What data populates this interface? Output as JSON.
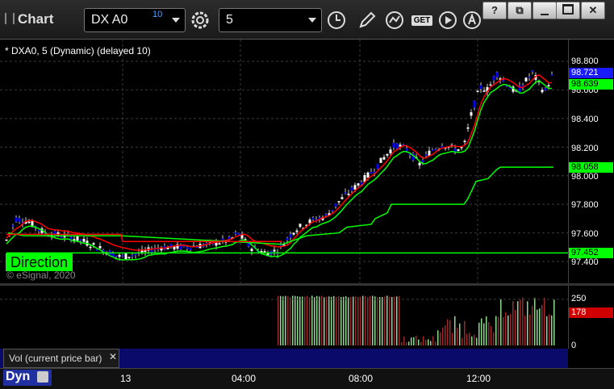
{
  "window": {
    "title": "Chart",
    "buttons": {
      "help": "?",
      "restore": "⧉",
      "minimize": "",
      "maximize": "",
      "close": "✕"
    }
  },
  "toolbar": {
    "symbol": "DX A0",
    "delay": "10",
    "interval": "5",
    "get_label": "GET",
    "icons": [
      "settings-gear-icon",
      "clock-icon",
      "pencil-icon",
      "study-icon",
      "get-data-icon",
      "play-icon",
      "alert-icon"
    ]
  },
  "chart": {
    "study_line": "* DXA0, 5 (Dynamic) (delayed 10)",
    "direction_label": "Direction",
    "copyright": "© eSignal, 2020",
    "price_axis": [
      "98.800",
      "98.600",
      "98.400",
      "98.200",
      "98.000",
      "97.800",
      "97.600",
      "97.400"
    ],
    "badges": {
      "last": "98.721",
      "green_upper": "98.639",
      "green_mid": "98.058",
      "green_low": "97.452"
    },
    "colors": {
      "up_candle": "#ffffff",
      "down_candle": "#0000ff",
      "fast_line": "#00ff00",
      "slow_line": "#ff0000",
      "channel": "#00ff00"
    }
  },
  "volume": {
    "legend": "Vol (current price bar)",
    "close": "✕",
    "axis": [
      "250",
      "0"
    ],
    "badge": "178"
  },
  "time_axis": {
    "labels": [
      "13",
      "04:00",
      "08:00",
      "12:00"
    ],
    "dyn_label": "Dyn"
  },
  "chart_data": {
    "type": "candlestick",
    "y_range": [
      97.35,
      98.85
    ],
    "volume_range": [
      0,
      280
    ]
  }
}
